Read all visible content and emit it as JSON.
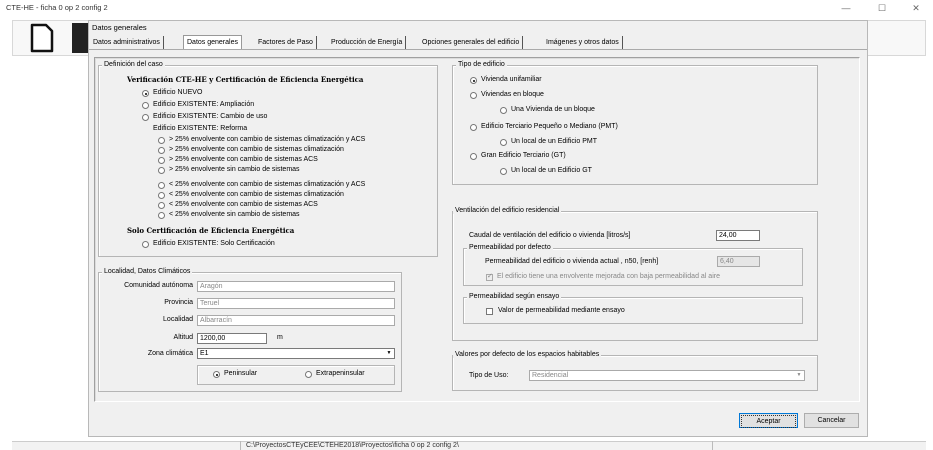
{
  "window": {
    "title": "CTE-HE - ficha 0 op 2 config 2",
    "controls": [
      "—",
      "☐",
      "✕"
    ]
  },
  "status_bar": {
    "path": "C:\\ProyectosCTEyCEE\\CTEHE2018\\Proyectos\\ficha 0 op 2 config 2\\"
  },
  "dialog": {
    "title": "Datos generales",
    "tabs": [
      {
        "label": "Datos administrativos"
      },
      {
        "label": "Datos generales",
        "active": true
      },
      {
        "label": "Factores de Paso"
      },
      {
        "label": "Producción de Energía"
      },
      {
        "label": "Opciones generales del edificio"
      },
      {
        "label": "Imágenes y otros datos"
      }
    ],
    "buttons": {
      "accept": "Aceptar",
      "cancel": "Cancelar"
    }
  },
  "definicion": {
    "legend": "Definición del caso",
    "heading1": "Verificación CTE-HE y Certificación de Eficiencia Energética",
    "options": [
      {
        "label": "Edificio NUEVO",
        "selected": true
      },
      {
        "label": "Edificio EXISTENTE: Ampliación",
        "selected": false
      },
      {
        "label": "Edificio EXISTENTE: Cambio de uso",
        "selected": false
      }
    ],
    "reforma_label": "Edificio EXISTENTE: Reforma",
    "reforma_gt": [
      "> 25% envolvente con cambio de sistemas climatización y ACS",
      "> 25% envolvente con cambio de sistemas climatización",
      "> 25% envolvente con cambio de sistemas ACS",
      "> 25% envolvente sin cambio de sistemas"
    ],
    "reforma_lt": [
      "< 25% envolvente con cambio de sistemas climatización y ACS",
      "< 25% envolvente con cambio de sistemas climatización",
      "< 25% envolvente con cambio de sistemas ACS",
      "< 25% envolvente sin cambio de sistemas"
    ],
    "heading2": "Solo Certificación de Eficiencia Energética",
    "solo_cert": "Edificio EXISTENTE: Solo Certificación"
  },
  "localidad": {
    "legend": "Localidad, Datos Climáticos",
    "comunidad_label": "Comunidad autónoma",
    "comunidad_value": "Aragón",
    "provincia_label": "Provincia",
    "provincia_value": "Teruel",
    "localidad_label": "Localidad",
    "localidad_value": "Albarracín",
    "altitud_label": "Altitud",
    "altitud_value": "1200,00",
    "altitud_unit": "m",
    "zona_label": "Zona climática",
    "zona_value": "E1",
    "peninsular": "Peninsular",
    "extrapeninsular": "Extrapeninsular"
  },
  "tipo": {
    "legend": "Tipo de edificio",
    "unifamiliar": "Vivienda unifamiliar",
    "bloque": "Viviendas en bloque",
    "una_vivienda": "Una Vivienda de un bloque",
    "terciario": "Edificio Terciario Pequeño o Mediano (PMT)",
    "local_pmt": "Un local de un Edificio PMT",
    "gran": "Gran Edificio Terciario (GT)",
    "local_gt": "Un local de un Edificio GT"
  },
  "ventilacion": {
    "legend": "Ventilación del edificio residencial",
    "caudal_label": "Caudal de ventilación del edificio o vivienda [litros/s]",
    "caudal_value": "24,00",
    "perm_defecto_legend": "Permeabilidad por defecto",
    "perm_label": "Permeabilidad del edificio o vivienda actual , n50, [renh]",
    "perm_value": "6,40",
    "mejorada_label": "El edificio tiene una envolvente mejorada con baja permeabilidad al aire",
    "perm_ensayo_legend": "Permeabilidad según ensayo",
    "ensayo_label": "Valor de permeabilidad mediante ensayo"
  },
  "espacios": {
    "legend": "Valores por defecto de los espacios habitables",
    "tipo_uso_label": "Tipo de Uso:",
    "tipo_uso_value": "Residencial"
  }
}
